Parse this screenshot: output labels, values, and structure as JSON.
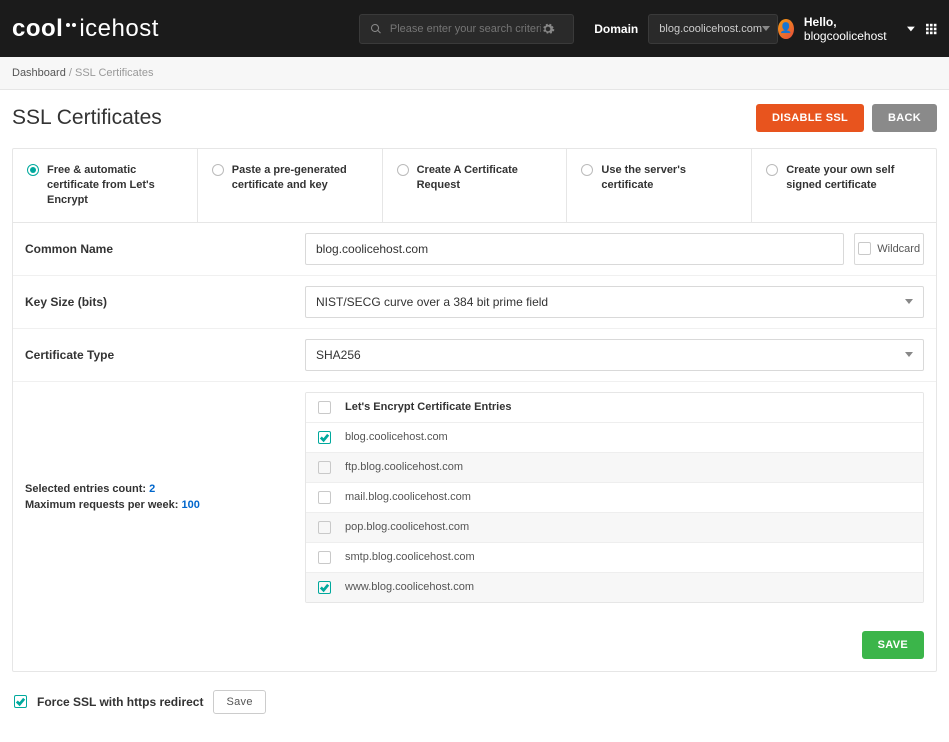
{
  "header": {
    "logo_bold": "cool",
    "logo_light": "host",
    "search_placeholder": "Please enter your search criteria",
    "domain_label": "Domain",
    "domain_value": "blog.coolicehost.com",
    "greeting_prefix": "Hello, ",
    "greeting_user": "blogcoolicehost"
  },
  "breadcrumb": {
    "root": "Dashboard",
    "sep": " / ",
    "current": "SSL Certificates"
  },
  "page": {
    "title": "SSL Certificates",
    "disable_btn": "DISABLE SSL",
    "back_btn": "BACK",
    "save_btn": "SAVE"
  },
  "tabs": [
    "Free & automatic certificate from Let's Encrypt",
    "Paste a pre-generated certificate and key",
    "Create A Certificate Request",
    "Use the server's certificate",
    "Create your own self signed certificate"
  ],
  "form": {
    "common_name_label": "Common Name",
    "common_name_value": "blog.coolicehost.com",
    "wildcard_label": "Wildcard",
    "key_size_label": "Key Size (bits)",
    "key_size_value": "NIST/SECG curve over a 384 bit prime field",
    "cert_type_label": "Certificate Type",
    "cert_type_value": "SHA256"
  },
  "entries": {
    "selected_label": "Selected entries count: ",
    "selected_value": "2",
    "max_label": "Maximum requests per week: ",
    "max_value": "100",
    "header": "Let's Encrypt Certificate Entries",
    "rows": [
      {
        "name": "blog.coolicehost.com",
        "checked": true
      },
      {
        "name": "ftp.blog.coolicehost.com",
        "checked": false
      },
      {
        "name": "mail.blog.coolicehost.com",
        "checked": false
      },
      {
        "name": "pop.blog.coolicehost.com",
        "checked": false
      },
      {
        "name": "smtp.blog.coolicehost.com",
        "checked": false
      },
      {
        "name": "www.blog.coolicehost.com",
        "checked": true
      }
    ]
  },
  "bottom": {
    "force_ssl_label": "Force SSL with https redirect",
    "force_ssl_checked": true,
    "save_btn": "Save"
  }
}
